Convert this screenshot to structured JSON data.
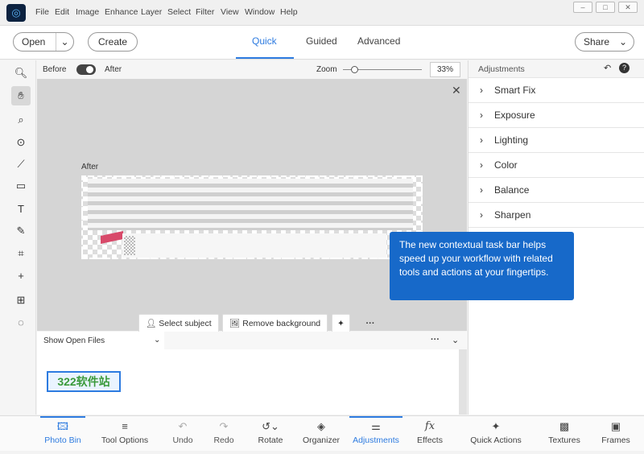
{
  "menu": [
    "File",
    "Edit",
    "Image",
    "Enhance",
    "Layer",
    "Select",
    "Filter",
    "View",
    "Window",
    "Help"
  ],
  "toolbar": {
    "open": "Open",
    "create": "Create",
    "share": "Share",
    "tabs": [
      "Quick",
      "Guided",
      "Advanced"
    ]
  },
  "options": {
    "before": "Before",
    "after": "After",
    "zoom_label": "Zoom",
    "zoom_value": "33%"
  },
  "canvas": {
    "label": "After",
    "select_subject": "Select subject",
    "remove_background": "Remove background",
    "more": "···"
  },
  "tooltip": "The new contextual task bar helps speed up your workflow with related tools and actions at your fingertips.",
  "adjustments": {
    "title": "Adjustments",
    "items": [
      "Smart Fix",
      "Exposure",
      "Lighting",
      "Color",
      "Balance",
      "Sharpen"
    ]
  },
  "bin": {
    "dropdown": "Show Open Files",
    "more": "···",
    "thumb_text": "322软件站"
  },
  "bottom": [
    "Photo Bin",
    "Tool Options",
    "Undo",
    "Redo",
    "Rotate",
    "Organizer",
    "Adjustments",
    "Effects",
    "Quick Actions",
    "Textures",
    "Frames"
  ],
  "colors": {
    "accent": "#2d7be0",
    "tooltip": "#1769c9"
  }
}
